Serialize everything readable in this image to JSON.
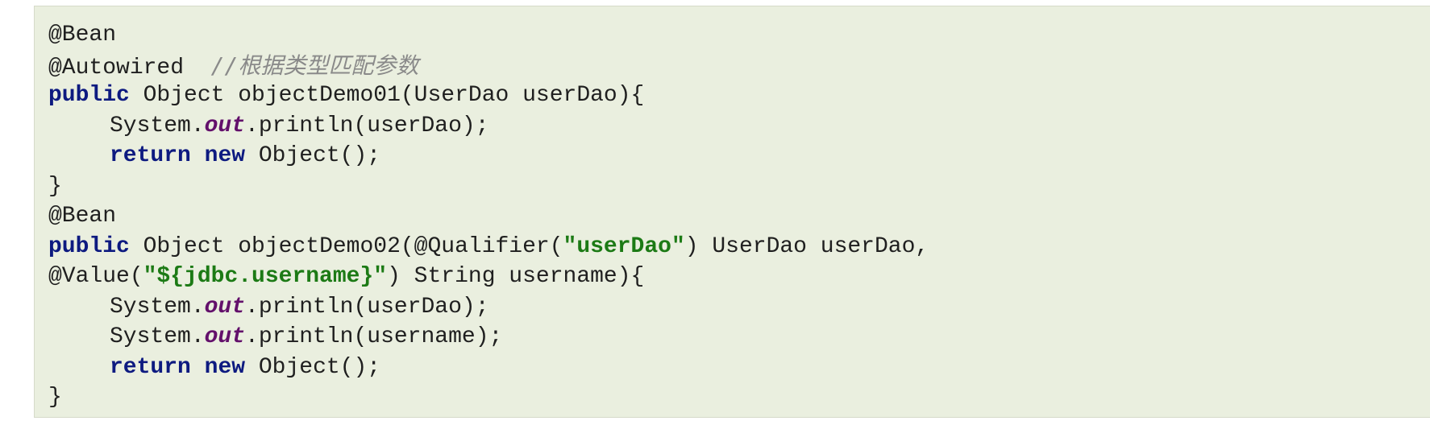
{
  "colors": {
    "background": "#eaefdf",
    "keyword": "#0d1a80",
    "static_field": "#63106b",
    "string": "#1c7a15",
    "comment": "#8a8a8a",
    "text": "#1f1f1f"
  },
  "code": {
    "line1": {
      "text": "@Bean"
    },
    "line2": {
      "text": "@Autowired  ",
      "comment": "//根据类型匹配参数"
    },
    "line3": {
      "kw": "public",
      "text": " Object objectDemo01(UserDao userDao){"
    },
    "line4": {
      "before": "System.",
      "field": "out",
      "after": ".println(userDao);"
    },
    "line5": {
      "kw1": "return",
      "sep": " ",
      "kw2": "new",
      "after": " Object();"
    },
    "line6": {
      "text": "}"
    },
    "line7": {
      "text": "@Bean"
    },
    "line8": {
      "kw": "public",
      "before": " Object objectDemo02(@Qualifier(",
      "str": "\"userDao\"",
      "after": ") UserDao userDao,"
    },
    "line9": {
      "before": "@Value(",
      "str": "\"${jdbc.username}\"",
      "after": ") String username){"
    },
    "line10": {
      "before": "System.",
      "field": "out",
      "after": ".println(userDao);"
    },
    "line11": {
      "before": "System.",
      "field": "out",
      "after": ".println(username);"
    },
    "line12": {
      "kw1": "return",
      "sep": " ",
      "kw2": "new",
      "after": " Object();"
    },
    "line13": {
      "text": "}"
    }
  }
}
